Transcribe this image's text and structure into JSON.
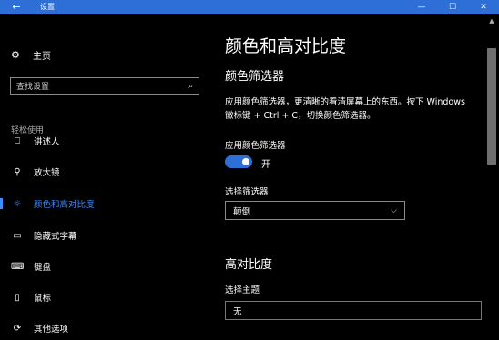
{
  "window": {
    "title": "设置",
    "back_icon": "←",
    "controls": {
      "minimize": "—",
      "maximize": "☐",
      "close": "✕"
    },
    "accent": "#2d6fd6"
  },
  "sidebar": {
    "home": {
      "icon": "gear-icon",
      "glyph": "⚙",
      "label": "主页"
    },
    "search": {
      "placeholder": "查找设置",
      "icon": "search-icon",
      "glyph": "⌕"
    },
    "section": "轻松使用",
    "items": [
      {
        "icon": "narrator-icon",
        "glyph": "⎕",
        "label": "讲述人",
        "active": false
      },
      {
        "icon": "magnifier-icon",
        "glyph": "⚲",
        "label": "放大镜",
        "active": false
      },
      {
        "icon": "brightness-icon",
        "glyph": "☼",
        "label": "颜色和高对比度",
        "active": true
      },
      {
        "icon": "closed-captions-icon",
        "glyph": "▭",
        "label": "隐藏式字幕",
        "active": false
      },
      {
        "icon": "keyboard-icon",
        "glyph": "⌨",
        "label": "键盘",
        "active": false
      },
      {
        "icon": "mouse-icon",
        "glyph": "▯",
        "label": "鼠标",
        "active": false
      },
      {
        "icon": "other-options-icon",
        "glyph": "⟳",
        "label": "其他选项",
        "active": false
      }
    ]
  },
  "main": {
    "title": "颜色和高对比度",
    "color_filter": {
      "heading": "颜色筛选器",
      "description": "应用颜色筛选器，更清晰的看清屏幕上的东西。按下 Windows 徽标键 + Ctrl + C，切换颜色筛选器。",
      "toggle_label": "应用颜色筛选器",
      "toggle_state": "开",
      "toggle_on": true,
      "select_label": "选择筛选器",
      "select_value": "颠倒"
    },
    "high_contrast": {
      "heading": "高对比度",
      "theme_label": "选择主题",
      "theme_value": "无"
    }
  }
}
